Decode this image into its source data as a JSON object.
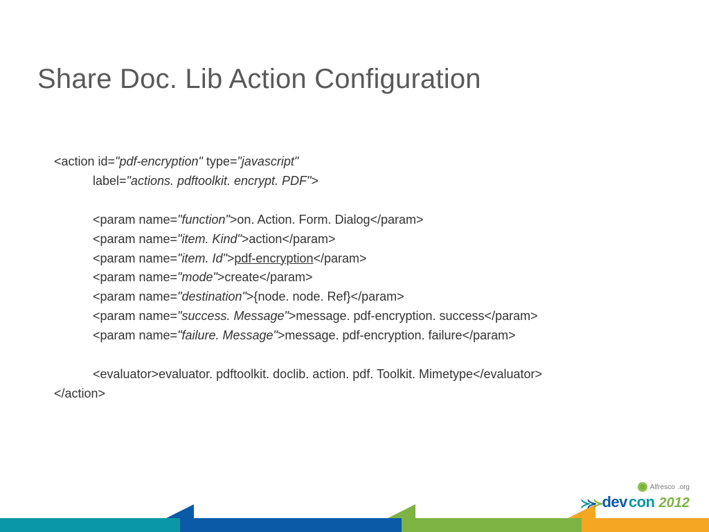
{
  "title": "Share Doc. Lib Action Configuration",
  "code": {
    "open_pre": "<action id=",
    "open_id": "\"pdf-encryption\"",
    "open_mid": " type=",
    "open_type": "\"javascript\"",
    "label_pre": "label=",
    "label_val": "\"actions. pdftoolkit. encrypt. PDF\"",
    "label_post": ">",
    "p1_pre": "<param name=",
    "p1_name": "\"function\"",
    "p1_mid": ">on. Action. Form. Dialog</param>",
    "p2_name": "\"item. Kind\"",
    "p2_mid": ">action</param>",
    "p3_name": "\"item. Id\"",
    "p3_mid_a": ">",
    "p3_val": "pdf-encryption",
    "p3_mid_b": "</param>",
    "p4_name": "\"mode\"",
    "p4_mid": ">create</param>",
    "p5_name": "\"destination\"",
    "p5_mid": ">{node. node. Ref}</param>",
    "p6_name": "\"success. Message\"",
    "p6_mid": ">message. pdf-encryption. success</param>",
    "p7_name": "\"failure. Message\"",
    "p7_mid": ">message. pdf-encryption. failure</param>",
    "eval": "<evaluator>evaluator. pdftoolkit. doclib. action. pdf. Toolkit. Mimetype</evaluator>",
    "close": "</action>"
  },
  "footer": {
    "brand": "Alfresco",
    "org": ".org",
    "dev": "dev",
    "con": "con",
    "year": "2012"
  }
}
